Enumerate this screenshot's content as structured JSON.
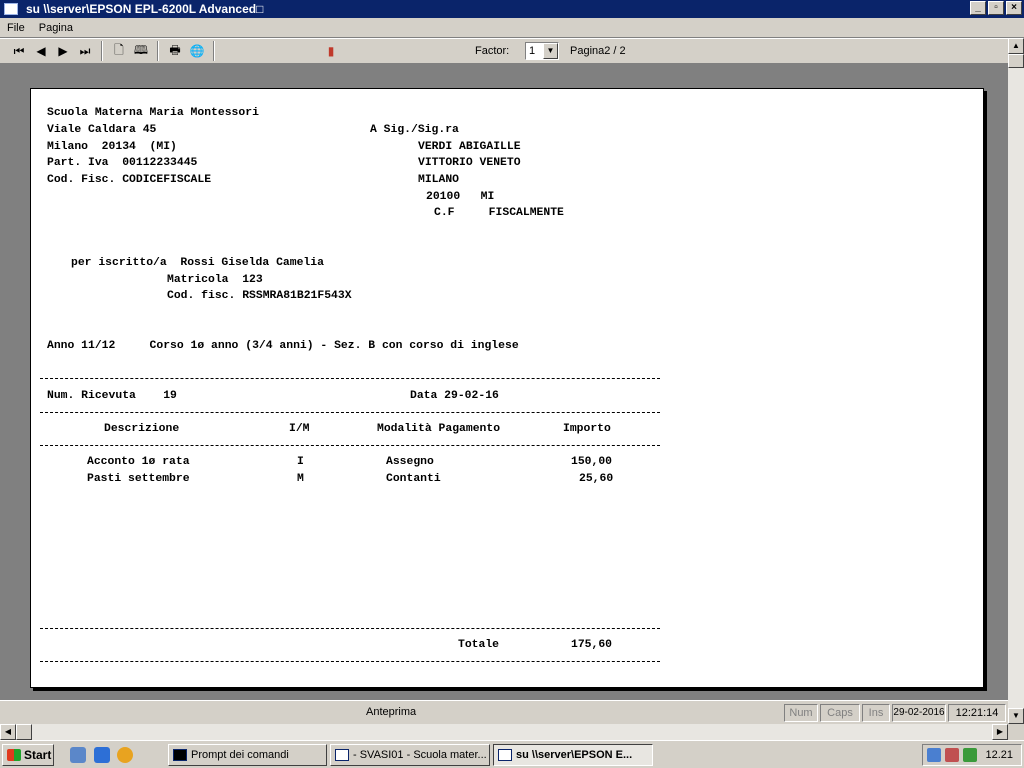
{
  "window": {
    "title": "su \\\\server\\EPSON EPL-6200L Advanced□"
  },
  "menu": [
    "File",
    "Pagina"
  ],
  "toolbar": {
    "factor_label": "Factor:",
    "factor_value": "1",
    "page_info": "Pagina2 / 2"
  },
  "receipt": {
    "school_name": "Scuola Materna Maria Montessori",
    "school_address": "Viale Caldara 45",
    "school_city": "Milano  20134  (MI)",
    "school_vat": "Part. Iva  00112233445",
    "school_cf": "Cod. Fisc. CODICEFISCALE",
    "recipient_header": "A Sig./Sig.ra",
    "recipient_name": "VERDI ABIGAILLE",
    "recipient_street": "VITTORIO VENETO",
    "recipient_city": "MILANO",
    "recipient_zip": "20100   MI",
    "recipient_cf": "C.F     FISCALMENTE",
    "student_line": "per iscritto/a  Rossi Giselda Camelia",
    "matricola": "Matricola  123",
    "student_cf": "Cod. fisc. RSSMRA81B21F543X",
    "course_line": "Anno 11/12     Corso 1ø anno (3/4 anni) - Sez. B con corso di inglese",
    "receipt_num": "Num. Ricevuta    19",
    "receipt_date": "Data 29-02-16",
    "col_desc": "Descrizione",
    "col_im": "I/M",
    "col_mod": "Modalità Pagamento",
    "col_imp": "Importo",
    "rows": [
      {
        "desc": "Acconto 1ø rata",
        "im": "I",
        "mod": "Assegno",
        "imp": "150,00"
      },
      {
        "desc": "Pasti settembre",
        "im": "M",
        "mod": "Contanti",
        "imp": "25,60"
      }
    ],
    "total_label": "Totale",
    "total_value": "175,60"
  },
  "status": {
    "label": "Anteprima",
    "num": "Num",
    "caps": "Caps",
    "ins": "Ins",
    "date": "29-02-2016",
    "time": "12:21:14"
  },
  "taskbar": {
    "start": "Start",
    "tasks": [
      "Prompt dei comandi",
      "- SVASI01 - Scuola mater...",
      "su \\\\server\\EPSON E..."
    ],
    "clock": "12.21"
  }
}
